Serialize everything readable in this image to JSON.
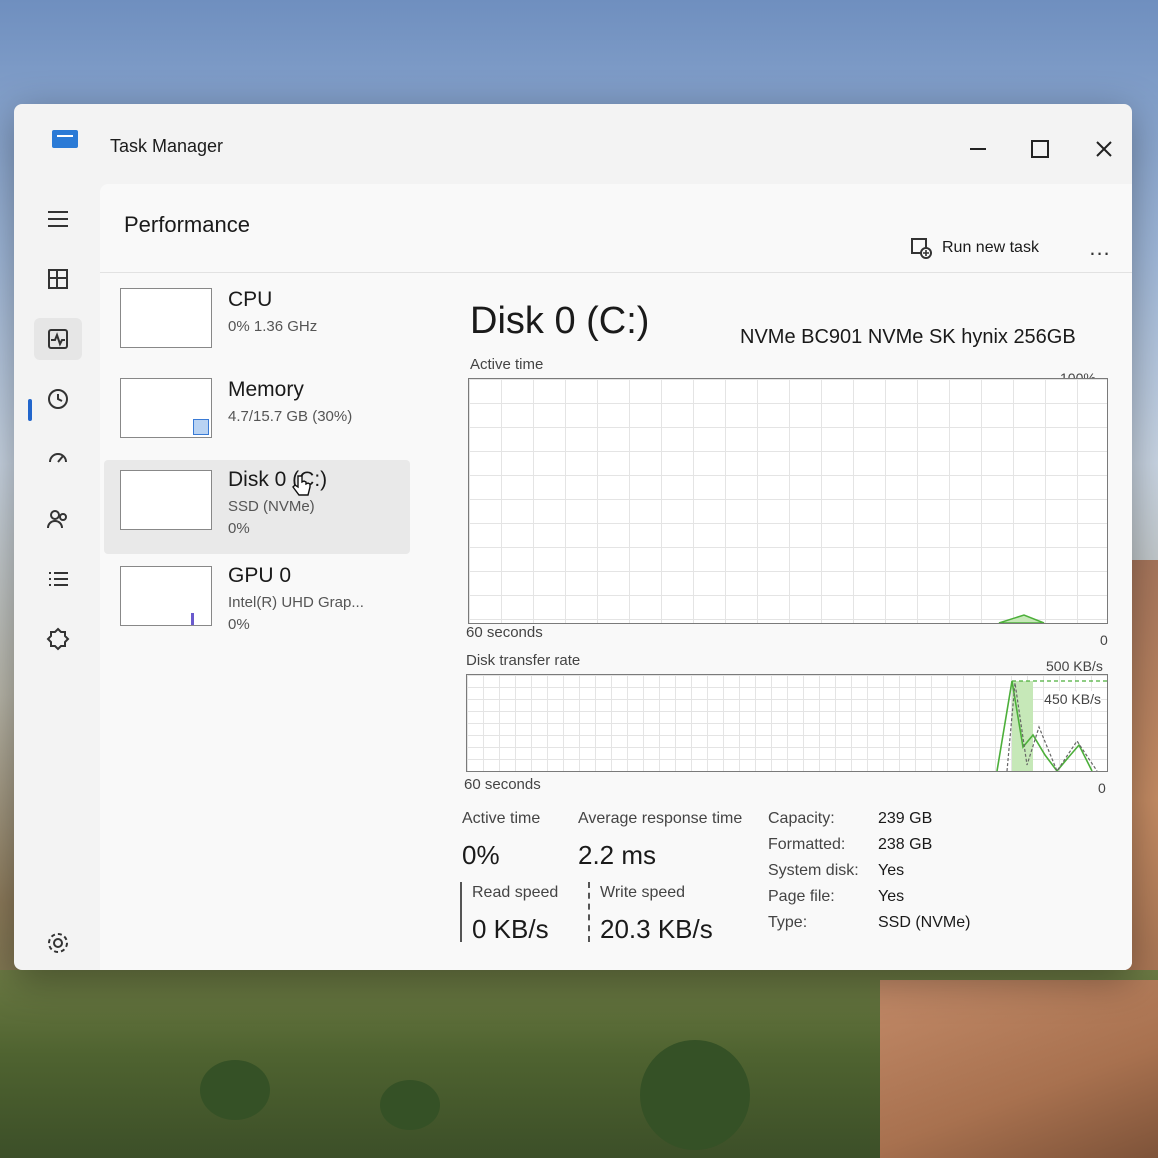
{
  "window": {
    "title": "Task Manager"
  },
  "header": {
    "title": "Performance",
    "run_new_task": "Run new task",
    "more": "..."
  },
  "nav": {
    "items": [
      "menu-icon",
      "processes-icon",
      "performance-icon",
      "app-history-icon",
      "startup-apps-icon",
      "users-icon",
      "details-icon",
      "services-icon",
      "settings-icon"
    ],
    "active": "performance-icon"
  },
  "devices": [
    {
      "name": "CPU",
      "sub": "0% 1.36 GHz",
      "sub2": ""
    },
    {
      "name": "Memory",
      "sub": "4.7/15.7 GB (30%)",
      "sub2": ""
    },
    {
      "name": "Disk 0 (C:)",
      "sub": "SSD (NVMe)",
      "sub2": "0%"
    },
    {
      "name": "GPU 0",
      "sub": "Intel(R) UHD Grap...",
      "sub2": "0%"
    }
  ],
  "selected_device": "Disk 0 (C:)",
  "detail": {
    "title": "Disk 0 (C:)",
    "model": "NVMe BC901 NVMe SK hynix 256GB",
    "active_time_graph": {
      "label": "Active time",
      "max_label": "100%",
      "time_label": "60 seconds",
      "min_label": "0"
    },
    "transfer_graph": {
      "label": "Disk transfer rate",
      "max_label": "500 KB/s",
      "mid_label": "450 KB/s",
      "time_label": "60 seconds",
      "min_label": "0"
    },
    "stats": {
      "active_time_label": "Active time",
      "active_time_value": "0%",
      "avg_response_label": "Average response time",
      "avg_response_value": "2.2 ms",
      "read_label": "Read speed",
      "read_value": "0 KB/s",
      "write_label": "Write speed",
      "write_value": "20.3 KB/s"
    },
    "properties": [
      {
        "k": "Capacity:",
        "v": "239 GB"
      },
      {
        "k": "Formatted:",
        "v": "238 GB"
      },
      {
        "k": "System disk:",
        "v": "Yes"
      },
      {
        "k": "Page file:",
        "v": "Yes"
      },
      {
        "k": "Type:",
        "v": "SSD (NVMe)"
      }
    ]
  },
  "colors": {
    "disk_accent": "#4caf3a",
    "disk_fill": "#c6e8b8",
    "memory_accent": "#3a7bd5",
    "gpu_accent": "#6a5acd"
  }
}
